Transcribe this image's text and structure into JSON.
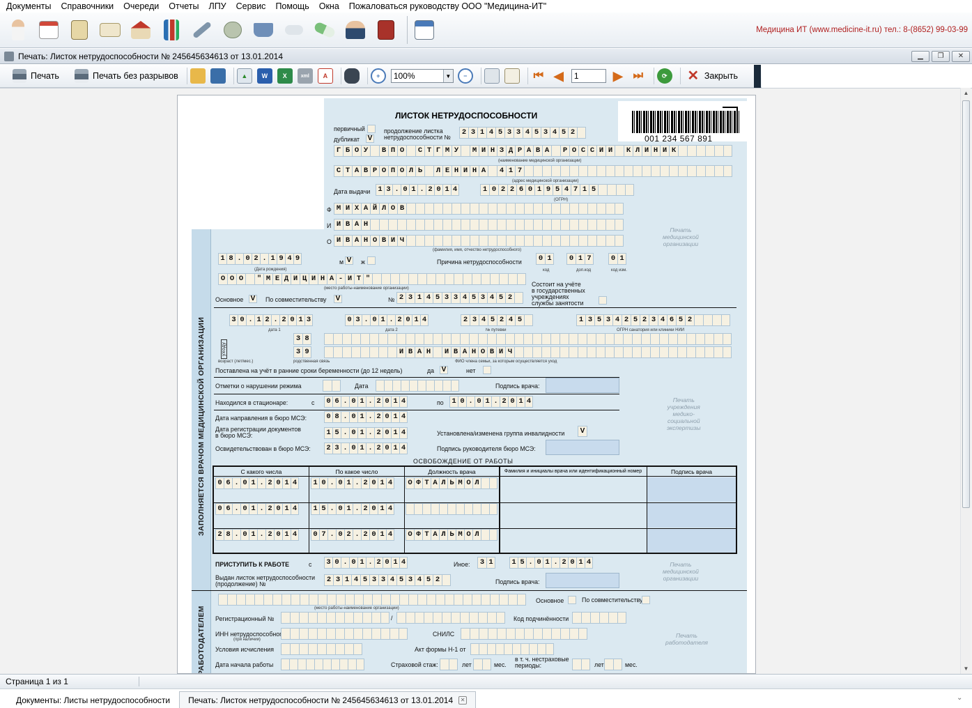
{
  "menu": [
    "Документы",
    "Справочники",
    "Очереди",
    "Отчеты",
    "ЛПУ",
    "Сервис",
    "Помощь",
    "Окна",
    "Пожаловаться руководству ООО \"Медицина-ИТ\""
  ],
  "vendor": "Медицина ИТ (www.medicine-it.ru) тел.: 8-(8652) 99-03-99",
  "window": {
    "title": "Печать: Листок нетрудоспособности № 245645634613 от 13.01.2014"
  },
  "toolbar": {
    "print": "Печать",
    "print_nobreaks": "Печать без разрывов",
    "zoom": "100%",
    "page": "1",
    "close": "Закрыть"
  },
  "status": {
    "page": "Страница 1 из 1"
  },
  "tabs": [
    {
      "label": "Документы: Листы нетрудоспособности"
    },
    {
      "label": "Печать: Листок нетрудоспособности № 245645634613 от 13.01.2014"
    }
  ],
  "form": {
    "title": "ЛИСТОК НЕТРУДОСПОСОБНОСТИ",
    "barcode": "001 234 567 891",
    "primary": "первичный",
    "duplicate": "дубликат",
    "duplicate_mark": "V",
    "continuation_l1": "продолжение листка",
    "continuation_l2": "нетрудоспособности №",
    "continuation_no": "2314533453452",
    "org": "ГБОУ ВПО СТГМУ МИНЗДРАВА РОССИИ КЛИНИК",
    "org_caption": "(наименование медицинской организации)",
    "address": "СТАВРОПОЛЬ ЛЕНИНА 417",
    "address_caption": "(адрес медицинской организации)",
    "issue_label": "Дата выдачи",
    "issue_date": "13.01.2014",
    "ogrn": "1022601954715",
    "ogrn_caption": "(ОГРН)",
    "f": "Ф",
    "i": "И",
    "o": "О",
    "last_name": "МИХАЙЛОВ",
    "first_name": "ИВАН",
    "patronymic": "ИВАНОВИЧ",
    "fio_caption": "(фамилия, имя, отчество нетрудоспособного)",
    "birth_date": "18.02.1949",
    "birth_caption": "(Дата рождения)",
    "m": "м",
    "m_mark": "V",
    "zh": "ж",
    "reason_label": "Причина нетрудоспособности",
    "reason_code": "01",
    "reason_add": "017",
    "reason_change": "01",
    "code_caption": "код",
    "add_caption": "доп.код",
    "change_caption": "код изм.",
    "employer": "ООО \"МЕДИЦИНА-ИТ\"",
    "employer_caption": "(место работы-наименование организации)",
    "job_main": "Основное",
    "job_main_mark": "V",
    "job_part": "По совместительству",
    "job_part_mark": "V",
    "no_label": "№",
    "job_no": "2314533453452",
    "employment_l1": "Состоит на учёте",
    "employment_l2": "в государственных",
    "employment_l3": "учреждениях",
    "employment_l4": "службы занятости",
    "date1": "30.12.2013",
    "date2": "03.01.2014",
    "voucher": "2345245",
    "sanatorium_ogrn": "1353425234652",
    "date1_caption": "дата 1",
    "date2_caption": "дата 2",
    "voucher_caption": "№ путевки",
    "sanatorium_caption": "ОГРН санатория или клиники НИИ",
    "care_label": "уходу",
    "relation1": "38",
    "relation2": "39",
    "care_fio": "ИВАН ИВАНОВИЧ",
    "age_caption": "возраст (лет/мес.)",
    "relation_caption": "родственная связь",
    "care_fio_caption": "ФИО члена семьи, за которым осуществляется уход",
    "pregnancy_label": "Поставлена на учёт в ранние сроки беременности (до 12 недель)",
    "yes": "да",
    "yes_mark": "V",
    "no": "нет",
    "violation_label": "Отметки о нарушении режима",
    "date_label": "Дата",
    "doctor_sign": "Подпись врача:",
    "hospital_label": "Находился в стационаре:",
    "from": "с",
    "to": "по",
    "hospital_from": "06.01.2014",
    "hospital_to": "10.01.2014",
    "mse_direct_label": "Дата направления в бюро МСЭ:",
    "mse_direct": "08.01.2014",
    "mse_reg_l1": "Дата регистрации документов",
    "mse_reg_l2": "в бюро МСЭ:",
    "mse_reg": "15.01.2014",
    "disability_label": "Установлена/изменена группа инвалидности",
    "disability_mark": "V",
    "mse_exam_label": "Освидетельствован в бюро МСЭ:",
    "mse_exam": "23.01.2014",
    "mse_head_sign": "Подпись руководителя бюро МСЭ:",
    "release_title": "ОСВОБОЖДЕНИЕ ОТ РАБОТЫ",
    "release_headers": [
      "С какого числа",
      "По какое число",
      "Должность врача",
      "Фамилия и инициалы врача или идентификационный номер",
      "Подпись врача"
    ],
    "release_rows": [
      {
        "from": "06.01.2014",
        "to": "10.01.2014",
        "position": "ОФТАЛЬМОЛ"
      },
      {
        "from": "06.01.2014",
        "to": "15.01.2014",
        "position": ""
      },
      {
        "from": "28.01.2014",
        "to": "07.02.2014",
        "position": "ОФТАЛЬМОЛ"
      }
    ],
    "return_label": "ПРИСТУПИТЬ К РАБОТЕ",
    "return_from": "с",
    "return_date": "30.01.2014",
    "other_label": "Иное:",
    "other_code": "31",
    "other_date": "15.01.2014",
    "issued_l1": "Выдан листок нетрудоспособности",
    "issued_l2": "(продолжение) №",
    "issued_no": "2314533453452",
    "doctor_section": "ЗАПОЛНЯЕТСЯ ВРАЧОМ МЕДИЦИНСКОЙ ОРГАНИЗАЦИИ",
    "employer_section": "РАБОТОДАТЕЛЕМ",
    "stamp_med": [
      "Печать",
      "медицинской",
      "организации"
    ],
    "stamp_mse": [
      "Печать",
      "учреждения",
      "медико-",
      "социальной",
      "экспертизы"
    ],
    "stamp_emp": [
      "Печать",
      "работодателя"
    ],
    "emp_main": "Основное",
    "emp_part": "По совместительству",
    "emp_caption": "(место работы-наименование организации)",
    "reg_no": "Регистрационный №",
    "sub_code": "Код подчинённости",
    "inn_label": "ИНН нетрудоспособного:",
    "inn_caption": "(при наличии)",
    "snils": "СНИЛС",
    "calc_label": "Условия исчисления",
    "act_label": "Акт формы Н-1 от",
    "start_label": "Дата начала работы",
    "insurance_label": "Страховой стаж:",
    "years": "лет",
    "months": "мес.",
    "nonins_l1": "в т. ч. нестраховые",
    "nonins_l2": "периоды:"
  }
}
